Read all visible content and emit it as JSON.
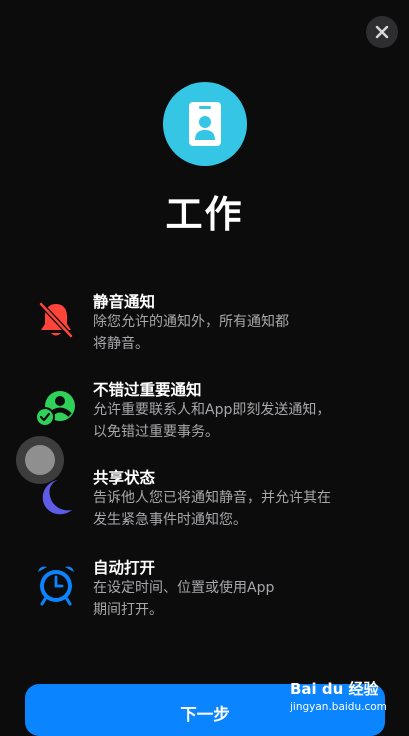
{
  "header": {
    "close_icon": "close-icon"
  },
  "focus": {
    "title": "工作",
    "icon": "id-badge-icon",
    "icon_bg": "#35c6e6"
  },
  "features": [
    {
      "icon": "bell-slash-icon",
      "title": "静音通知",
      "desc_line1": "除您允许的通知外，所有通知都",
      "desc_line2": "将静音。"
    },
    {
      "icon": "person-check-icon",
      "title": "不错过重要通知",
      "desc_line1": "允许重要联系人和App即刻发送通知，",
      "desc_line2": "以免错过重要事务。"
    },
    {
      "icon": "moon-icon",
      "title": "共享状态",
      "desc_line1": "告诉他人您已将通知静音，并允许其在",
      "desc_line2": "发生紧急事件时通知您。"
    },
    {
      "icon": "alarm-clock-icon",
      "title": "自动打开",
      "desc_line1": "在设定时间、位置或使用App",
      "desc_line2": "期间打开。"
    }
  ],
  "footer": {
    "next_label": "下一步",
    "accent": "#0a84ff"
  },
  "watermark": {
    "brand": "Bai du 经验",
    "site": "jingyan.baidu.com"
  }
}
